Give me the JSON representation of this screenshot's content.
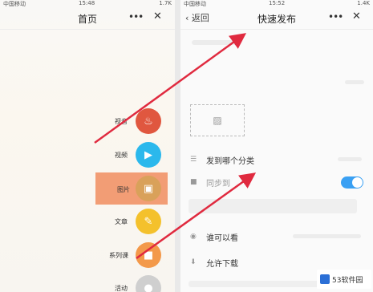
{
  "left_phone": {
    "status": {
      "carrier": "中国移动",
      "time": "15:48",
      "battery": "1.7K"
    },
    "title": "首页",
    "more": "•••",
    "close": "✕",
    "menu": [
      {
        "label": "视音",
        "icon": "flame-icon",
        "color": "#e0573f"
      },
      {
        "label": "视频",
        "icon": "video-icon",
        "color": "#2bb8ec"
      },
      {
        "label": "图片",
        "icon": "image-icon",
        "color": "#e9b54a"
      },
      {
        "label": "文章",
        "icon": "article-icon",
        "color": "#f4c12c"
      },
      {
        "label": "系列课",
        "icon": "course-icon",
        "color": "#f3994a"
      },
      {
        "label": "活动",
        "icon": "event-icon",
        "color": "#cfcfcf"
      }
    ],
    "highlight_color": "#f08d5f"
  },
  "right_phone": {
    "status": {
      "carrier": "中国移动",
      "time": "15:52",
      "battery": "1.4K"
    },
    "back": "返回",
    "title": "快速发布",
    "more": "•••",
    "close": "✕",
    "upload_icon": "image-icon",
    "rows": [
      {
        "icon": "list-icon",
        "text": "发到哪个分类"
      },
      {
        "icon": "sync-icon",
        "text": "同步到"
      },
      {
        "icon": "eye-icon",
        "text": "谁可以看"
      },
      {
        "icon": "download-icon",
        "text": "允许下载"
      }
    ],
    "toggle_on": true,
    "accent": "#3aa0f3"
  },
  "arrows_color": "#e02a3f",
  "watermark": "53软件园"
}
